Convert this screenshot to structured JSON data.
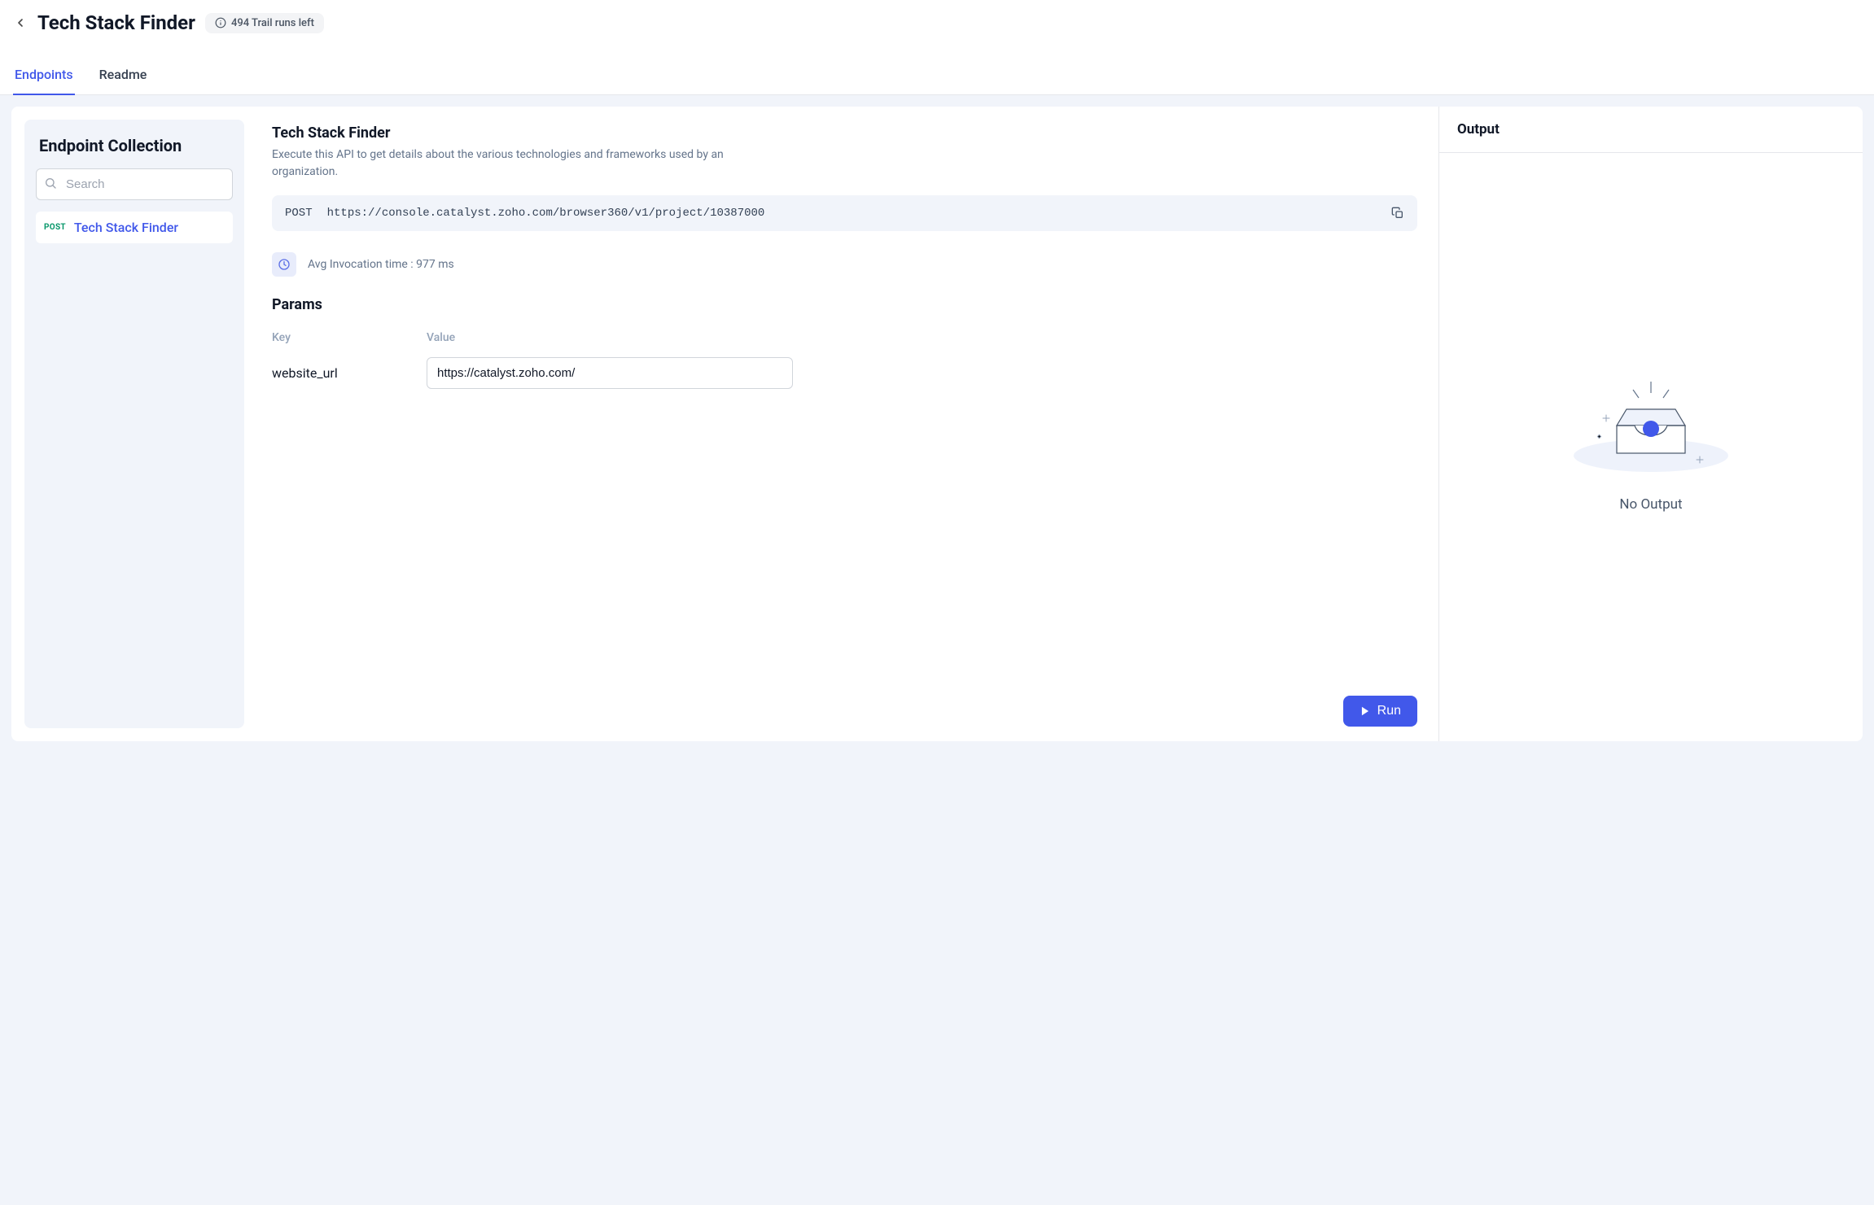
{
  "header": {
    "title": "Tech Stack Finder",
    "trial_badge": "494 Trail runs left"
  },
  "tabs": {
    "endpoints": "Endpoints",
    "readme": "Readme"
  },
  "sidebar": {
    "title": "Endpoint Collection",
    "search_placeholder": "Search",
    "items": [
      {
        "method": "POST",
        "label": "Tech Stack Finder"
      }
    ]
  },
  "main": {
    "title": "Tech Stack Finder",
    "description": "Execute this API to get details about the various technologies and frameworks used by an organization.",
    "request": {
      "method": "POST",
      "url": "https://console.catalyst.zoho.com/browser360/v1/project/10387000"
    },
    "avg_invocation": "Avg Invocation time : 977 ms",
    "params_title": "Params",
    "params_header": {
      "key": "Key",
      "value": "Value"
    },
    "params": [
      {
        "key": "website_url",
        "value": "https://catalyst.zoho.com/"
      }
    ],
    "run_label": "Run"
  },
  "output": {
    "title": "Output",
    "empty_text": "No Output"
  }
}
